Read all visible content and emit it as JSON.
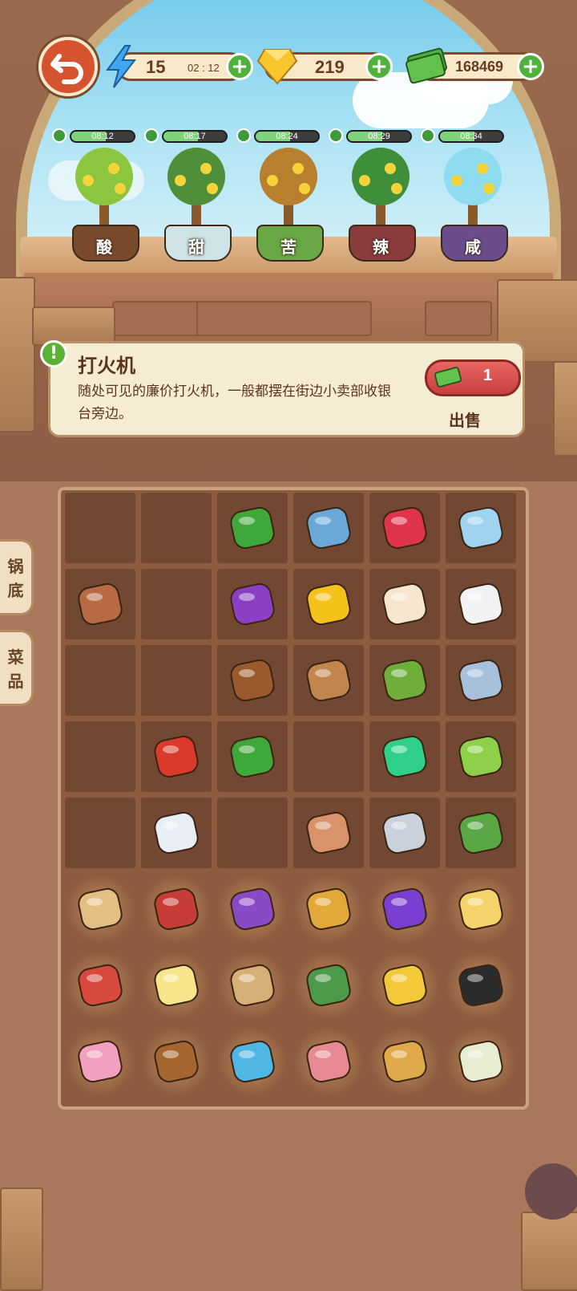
{
  "resources": {
    "energy": {
      "value": "15",
      "timer": "02 : 12"
    },
    "gems": {
      "value": "219"
    },
    "cash": {
      "value": "168469"
    }
  },
  "plants": [
    {
      "label": "酸",
      "timer": "08:12",
      "progress": 0.55
    },
    {
      "label": "甜",
      "timer": "08:17",
      "progress": 0.55
    },
    {
      "label": "苦",
      "timer": "08:24",
      "progress": 0.55
    },
    {
      "label": "辣",
      "timer": "08:29",
      "progress": 0.55
    },
    {
      "label": "咸",
      "timer": "08:34",
      "progress": 0.55
    }
  ],
  "info": {
    "name": "打火机",
    "description": "随处可见的廉价打火机，一般都摆在街边小卖部收银台旁边。",
    "sell_price": "1",
    "sell_label": "出售"
  },
  "side_tabs": [
    {
      "label": "锅底"
    },
    {
      "label": "菜品"
    }
  ],
  "grid": {
    "rows": [
      [
        "",
        "",
        "green-chili",
        "fish",
        "lychee",
        "phone"
      ],
      [
        "tofu",
        "",
        "candy",
        "bell-pepper",
        "cake",
        "earbud"
      ],
      [
        "",
        "",
        "coffee-beans",
        "spice-bowl",
        "tea-leaves",
        "key"
      ],
      [
        "",
        "red-chili",
        "green-chili",
        "",
        "lighter",
        "lunchbox"
      ],
      [
        "",
        "salt-bowl",
        "",
        "dried-fish",
        "cd-case",
        "notebook"
      ],
      [
        "wallet",
        "sneaker",
        "hero-toy",
        "gold-key",
        "rose",
        "butter-box"
      ],
      [
        "red-wallet",
        "mahjong-tile",
        "record-player",
        "note-book",
        "trading-card",
        "smartphone"
      ],
      [
        "plush-doll",
        "walnut",
        "dolphin-toy",
        "headphones",
        "hand-mirror",
        "oven-mitt"
      ]
    ],
    "glow_rows_from": 5
  }
}
